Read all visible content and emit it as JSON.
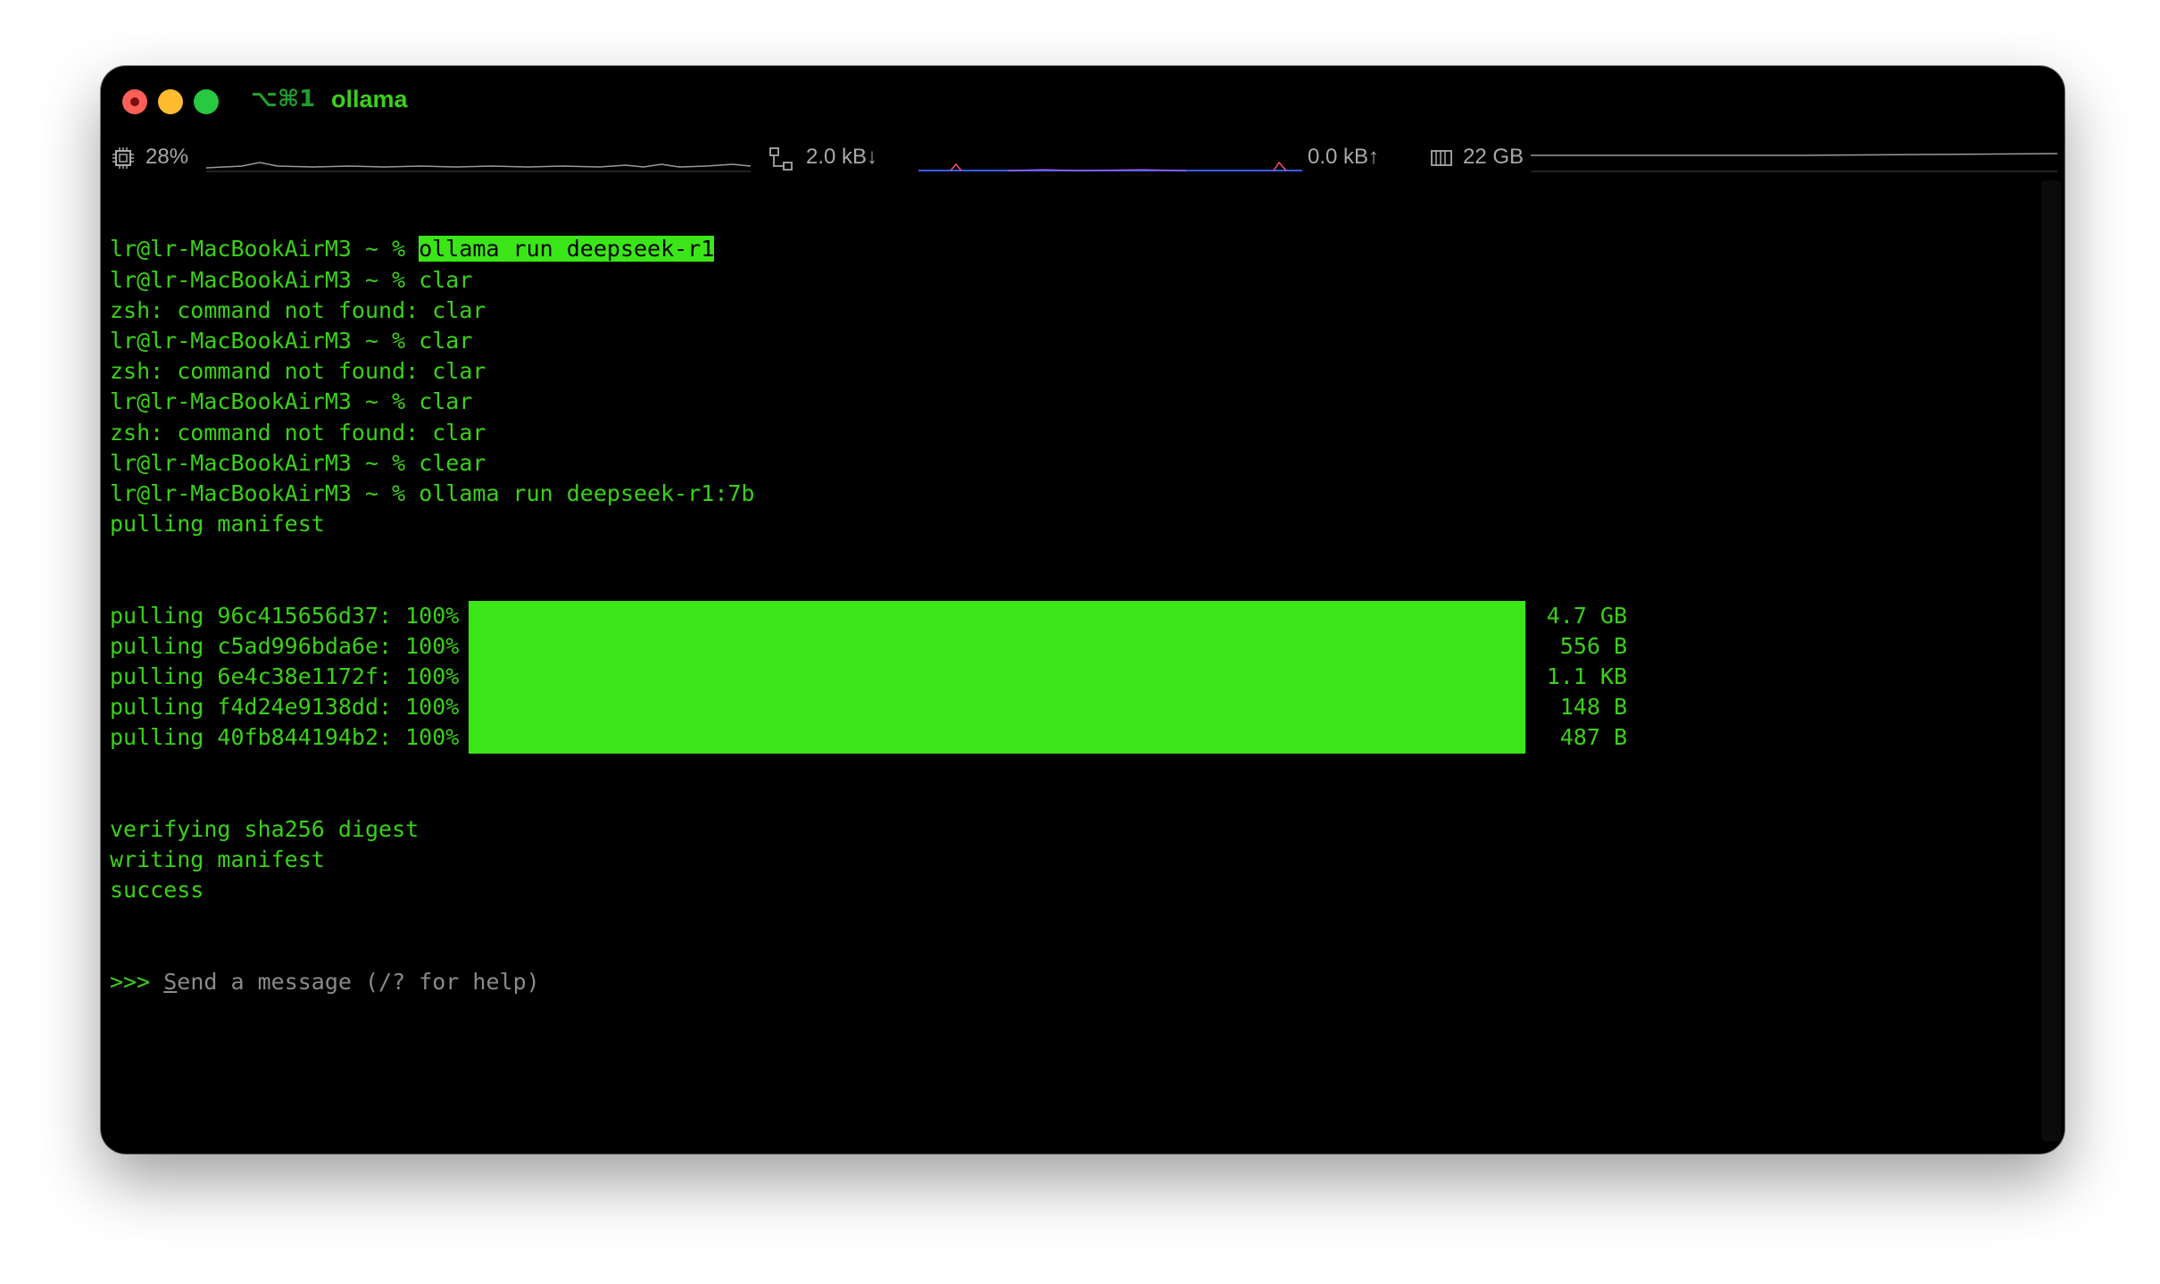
{
  "window": {
    "shortcut": "⌥⌘1",
    "title": "ollama"
  },
  "status": {
    "cpu": "28%",
    "net_down": "2.0 kB↓",
    "net_up": "0.0 kB↑",
    "memory": "22 GB"
  },
  "terminal": {
    "prompt": "lr@lr-MacBookAirM3 ~ % ",
    "lines": [
      {
        "type": "prompt",
        "cmd": "ollama run deepseek-r1",
        "highlight": true
      },
      {
        "type": "prompt",
        "cmd": "clar"
      },
      {
        "type": "output",
        "text": "zsh: command not found: clar"
      },
      {
        "type": "prompt",
        "cmd": "clar"
      },
      {
        "type": "output",
        "text": "zsh: command not found: clar"
      },
      {
        "type": "prompt",
        "cmd": "clar"
      },
      {
        "type": "output",
        "text": "zsh: command not found: clar"
      },
      {
        "type": "prompt",
        "cmd": "clear"
      },
      {
        "type": "prompt",
        "cmd": "ollama run deepseek-r1:7b"
      },
      {
        "type": "output",
        "text": "pulling manifest"
      }
    ],
    "pulls": [
      {
        "label": "pulling 96c415656d37: 100%",
        "progress": 1.0,
        "size": "4.7 GB"
      },
      {
        "label": "pulling c5ad996bda6e: 100%",
        "progress": 1.0,
        "size": "556 B"
      },
      {
        "label": "pulling 6e4c38e1172f: 100%",
        "progress": 1.0,
        "size": "1.1 KB"
      },
      {
        "label": "pulling f4d24e9138dd: 100%",
        "progress": 1.0,
        "size": "148 B"
      },
      {
        "label": "pulling 40fb844194b2: 100%",
        "progress": 1.0,
        "size": "487 B"
      }
    ],
    "after": [
      "verifying sha256 digest",
      "writing manifest",
      "success"
    ],
    "input_prefix": ">>> ",
    "input_placeholder_first": "S",
    "input_placeholder_rest": "end a message (/? for help)"
  },
  "colors": {
    "green": "#3ad117",
    "highlight": "#3ae617",
    "background": "#000000"
  }
}
